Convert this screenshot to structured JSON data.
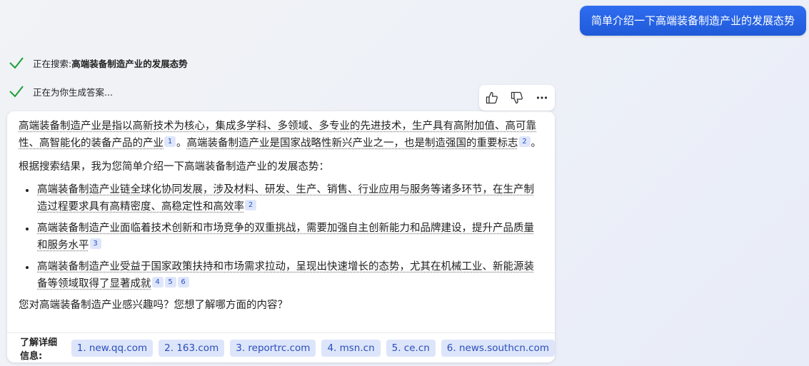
{
  "user_query": "简单介绍一下高端装备制造产业的发展态势",
  "status": {
    "searching_prefix": "正在搜索: ",
    "searching_term": "高端装备制造产业的发展态势",
    "generating": "正在为你生成答案..."
  },
  "actions": {
    "icons": [
      "thumbs-up-icon",
      "thumbs-down-icon",
      "more-icon"
    ]
  },
  "answer": {
    "p1_a": "高端装备制造产业是指以高新技术为核心，集成多学科、多领域、多专业的先进技术，生产具有高附加值、高可靠性、高智能化的装备产品的产业",
    "p1_c1": "1",
    "p1_b": "。",
    "p1_c": "高端装备制造产业是国家战略性新兴产业之一，也是制造强国的重要标志",
    "p1_c2": "2",
    "p1_d": "。",
    "intro": "根据搜索结果，我为您简单介绍一下高端装备制造产业的发展态势：",
    "bullets": [
      {
        "text": "高端装备制造产业链全球化协同发展，涉及材料、研发、生产、销售、行业应用与服务等诸多环节，在生产制造过程要求具有高精密度、高稳定性和高效率",
        "cites": [
          "2"
        ]
      },
      {
        "text": "高端装备制造产业面临着技术创新和市场竞争的双重挑战，需要加强自主创新能力和品牌建设，提升产品质量和服务水平",
        "cites": [
          "3"
        ]
      },
      {
        "text": "高端装备制造产业受益于国家政策扶持和市场需求拉动，呈现出快速增长的态势，尤其在机械工业、新能源装备等领域取得了显著成就",
        "cites": [
          "4",
          "5",
          "6"
        ]
      }
    ],
    "question": "您对高端装备制造产业感兴趣吗？您想了解哪方面的内容？"
  },
  "footer": {
    "label": "了解详细信息:",
    "links": [
      "1. new.qq.com",
      "2. 163.com",
      "3. reportrc.com",
      "4. msn.cn",
      "5. ce.cn",
      "6. news.southcn.com"
    ]
  },
  "colors": {
    "accent": "#1f5ad8",
    "check": "#1e9e3a",
    "citation_bg": "#dfe6fb"
  }
}
